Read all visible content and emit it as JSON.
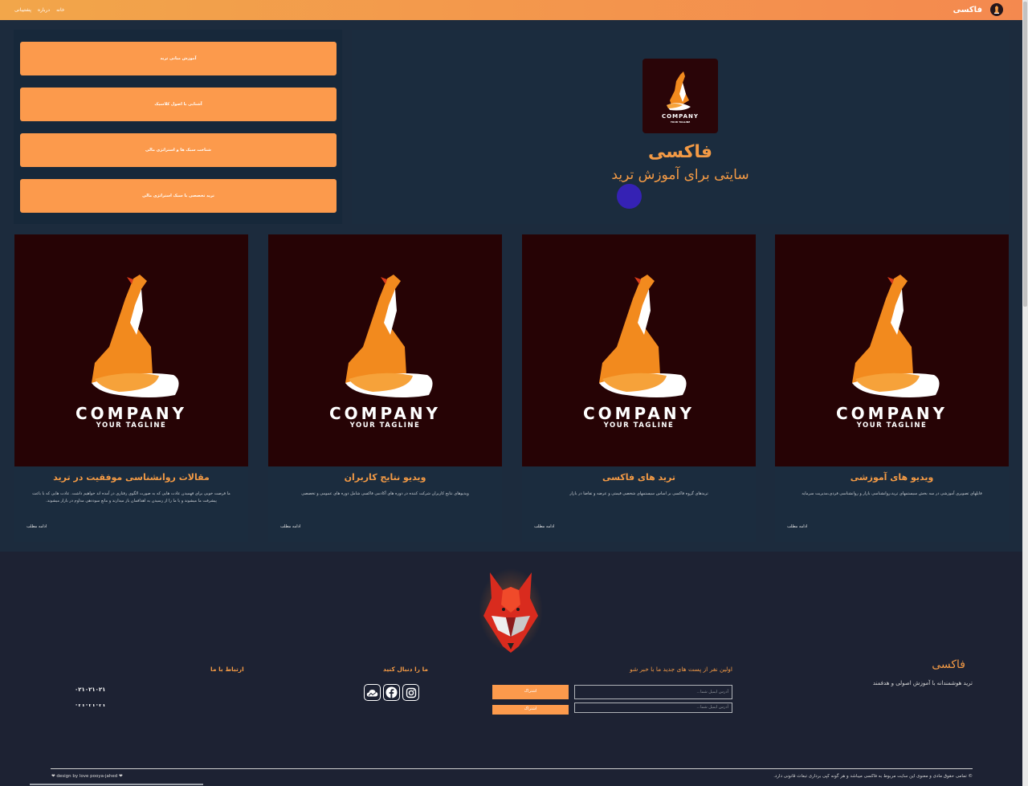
{
  "navbar": {
    "brand": "فاکسی",
    "links": [
      "خانه",
      "درباره",
      "پشتیبانی"
    ],
    "colors": {
      "gradient_start": "#f2a64a",
      "gradient_end": "#f4894f"
    }
  },
  "menu": {
    "items": [
      "آموزش مبانی ترید",
      "آشنایی با اصول کلاسیک",
      "شناخت سبک ها و استراتژی مالی",
      "ترید تخصصی با سبک استراتژی مالی"
    ]
  },
  "hero": {
    "logo_text": "COMPANY",
    "logo_tagline": "YOUR TAGLINE",
    "title": "فاکسی",
    "subtitle": "سایتی برای آموزش ترید"
  },
  "cards": [
    {
      "image_text": "COMPANY",
      "image_tagline": "YOUR TAGLINE",
      "title": "مقالات روانشناسی موفقیت در ترید",
      "description": "ما فرصت خوبی برای فهمیدن عادت هایی که به صورت الگوی رفتاری در آمده اند خواهیم داشت. عادت هایی که با باعث پیشرفت ما میشوند و یا ما را از رسیدن به اهدافمان باز میدارند و مانع سوددهی مداوم در بازار میشوند.",
      "more": "ادامه مطلب"
    },
    {
      "image_text": "COMPANY",
      "image_tagline": "YOUR TAGLINE",
      "title": "ویدیو نتایج کاربران",
      "description": "ویدیوهای نتایج کاربران شرکت کننده در دوره های آکادمی فاکسی شامل دوره های عمومی و تخصصی",
      "more": "ادامه مطلب"
    },
    {
      "image_text": "COMPANY",
      "image_tagline": "YOUR TAGLINE",
      "title": "ترید های فاکسی",
      "description": "تریدهای گروه فاکسی بر اساس سیستمهای شخصی قیمتی و عرضه و تقاضا در بازار",
      "more": "ادامه مطلب"
    },
    {
      "image_text": "COMPANY",
      "image_tagline": "YOUR TAGLINE",
      "title": "ویدیو های آموزشی",
      "description": "فایلهای تصویری آموزشی در سه بخش سیستمهای ترید،روانشناسی بازار و روانشناسی فردی،مدیریت سرمایه",
      "more": "ادامه مطلب"
    }
  ],
  "footer": {
    "brand_title": "فاکسی",
    "brand_desc": "ترید هوشمندانه با آموزش اصولی و هدفمند",
    "newsletter_title": "اولین نفر از پست های جدید ما با خبر شو",
    "email_placeholder": "آدرس ایمیل شما...",
    "subscribe_label": "اشتراک",
    "follow_title": "ما را دنبال کنید",
    "social_icons": [
      "instagram-icon",
      "facebook-icon",
      "cloud-icon"
    ],
    "contact_title": "ارتباط با ما",
    "phone": "۰۲۱۰۲۱۰۲۱",
    "copyright": "©  تمامی حقوق مادی و معنوی این سایت مربوط به فاکسی میباشد و هر گونه کپی برداری تبعات قانونی دارد.",
    "design_credit": "❤ design by love pooya-jahed ❤"
  },
  "accent_color": "#f39a45",
  "button_color": "#fc9a4c"
}
